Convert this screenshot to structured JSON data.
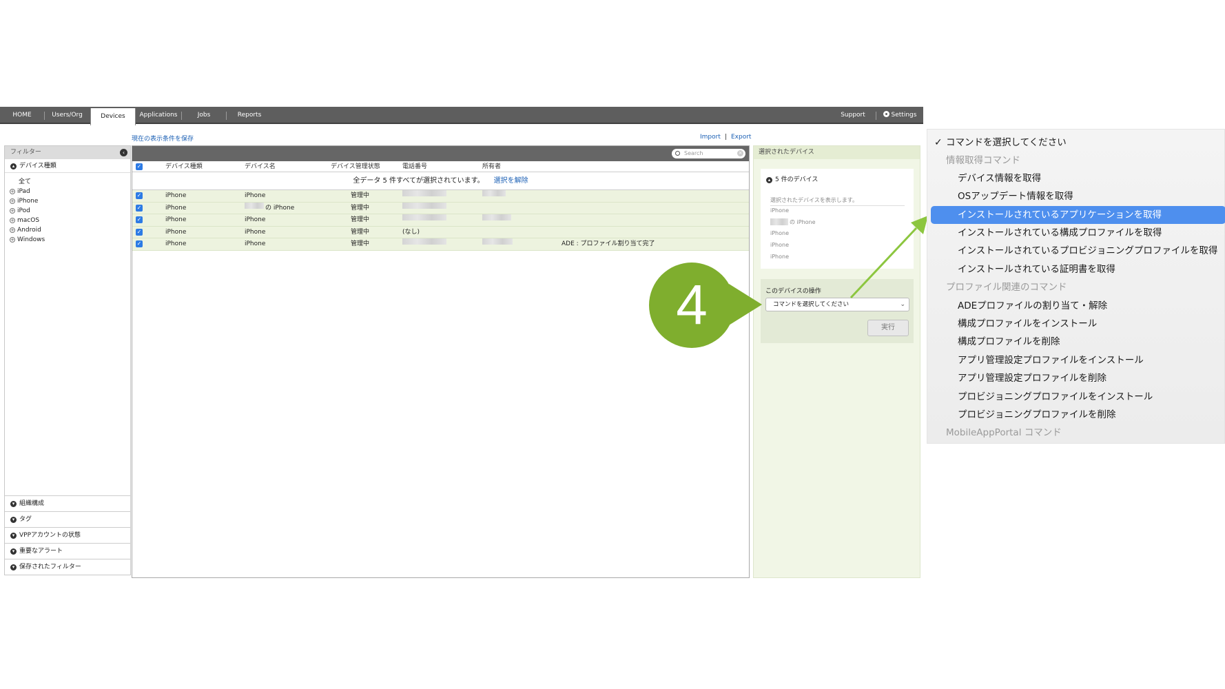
{
  "nav": {
    "tabs": [
      "HOME",
      "Users/Org",
      "Devices",
      "Applications",
      "Jobs",
      "Reports"
    ],
    "active_tab": "Devices",
    "support": "Support",
    "settings": "Settings"
  },
  "links": {
    "save_view": "現在の表示条件を保存",
    "import": "Import",
    "separator": "|",
    "export": "Export"
  },
  "sidebar": {
    "title": "フィルター",
    "collapse_icon": "‹",
    "section_device_type": "デバイス種類",
    "items": [
      "全て",
      "iPad",
      "iPhone",
      "iPod",
      "macOS",
      "Android",
      "Windows"
    ],
    "bottom_sections": [
      "組織構成",
      "タグ",
      "VPPアカウントの状態",
      "重要なアラート",
      "保存されたフィルター"
    ]
  },
  "table": {
    "search_placeholder": "Search",
    "columns": [
      "デバイス種類",
      "デバイス名",
      "デバイス管理状態",
      "電話番号",
      "所有者"
    ],
    "selection_text": "全データ 5 件すべてが選択されています。",
    "clear_selection": "選択を解除",
    "rows": [
      {
        "type": "iPhone",
        "name": "iPhone",
        "status": "管理中",
        "phone": "",
        "owner": "",
        "note": ""
      },
      {
        "type": "iPhone",
        "name": "の iPhone",
        "status": "管理中",
        "phone": "",
        "owner": "",
        "note": ""
      },
      {
        "type": "iPhone",
        "name": "iPhone",
        "status": "管理中",
        "phone": "",
        "owner": "",
        "note": ""
      },
      {
        "type": "iPhone",
        "name": "iPhone",
        "status": "管理中",
        "phone": "(なし)",
        "owner": "",
        "note": ""
      },
      {
        "type": "iPhone",
        "name": "iPhone",
        "status": "管理中",
        "phone": "",
        "owner": "",
        "note": "ADE : プロファイル割り当て完了"
      }
    ]
  },
  "right_panel": {
    "title": "選択されたデバイス",
    "count_label": "5 件のデバイス",
    "description": "選択されたデバイスを表示します。",
    "devices": [
      "iPhone",
      "の iPhone",
      "iPhone",
      "iPhone",
      "iPhone"
    ],
    "operation_label": "このデバイスの操作",
    "select_value": "コマンドを選択してください",
    "run_button": "実行"
  },
  "step_badge": "4",
  "colors": {
    "accent_green": "#7fae2e",
    "menu_highlight": "#4e8fee",
    "link_blue": "#1a5fb4"
  },
  "menu": {
    "checked_item": "コマンドを選択してください",
    "group_info": "情報取得コマンド",
    "info_items": [
      "デバイス情報を取得",
      "OSアップデート情報を取得",
      "インストールされているアプリケーションを取得",
      "インストールされている構成プロファイルを取得",
      "インストールされているプロビジョニングプロファイルを取得",
      "インストールされている証明書を取得"
    ],
    "highlighted_index": 2,
    "group_profile": "プロファイル関連のコマンド",
    "profile_items": [
      "ADEプロファイルの割り当て・解除",
      "構成プロファイルをインストール",
      "構成プロファイルを削除",
      "アプリ管理設定プロファイルをインストール",
      "アプリ管理設定プロファイルを削除",
      "プロビジョニングプロファイルをインストール",
      "プロビジョニングプロファイルを削除"
    ],
    "group_mobile": "MobileAppPortal コマンド"
  }
}
